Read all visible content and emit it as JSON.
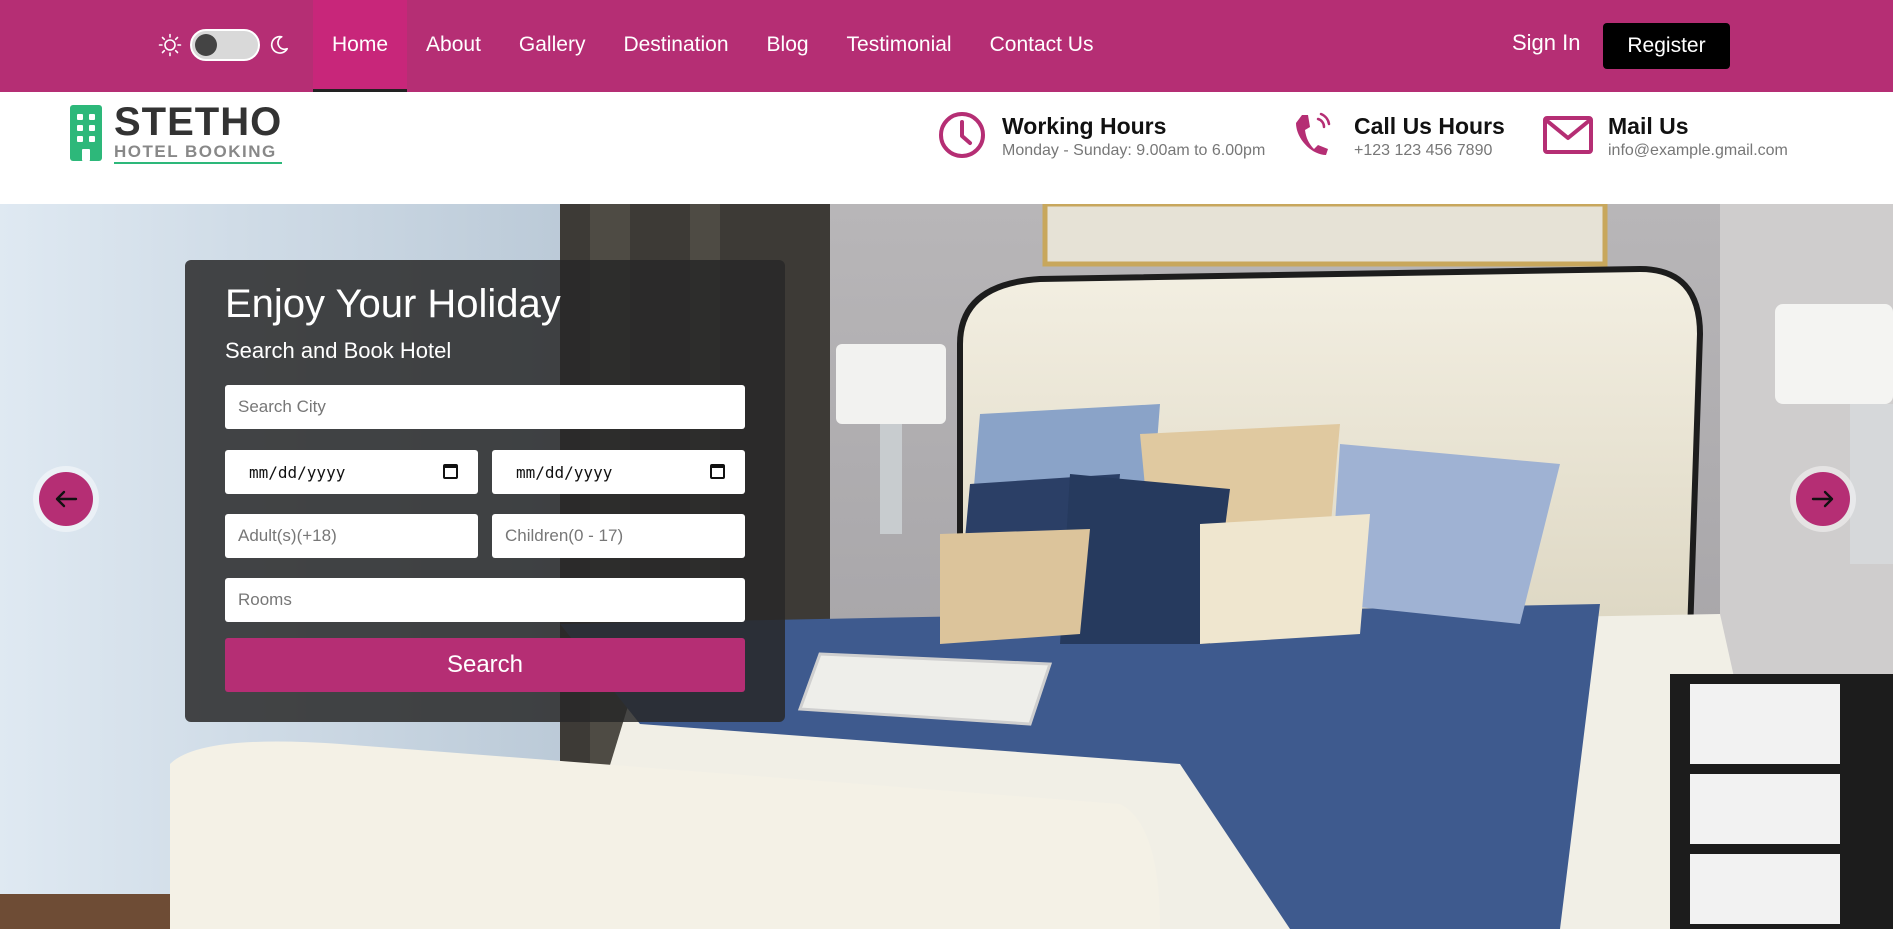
{
  "nav": {
    "links": [
      {
        "label": "Home",
        "active": true
      },
      {
        "label": "About"
      },
      {
        "label": "Gallery"
      },
      {
        "label": "Destination"
      },
      {
        "label": "Blog"
      },
      {
        "label": "Testimonial"
      },
      {
        "label": "Contact Us"
      }
    ],
    "sign_in": "Sign In",
    "register": "Register",
    "theme_toggle": {
      "light_icon": "sun-icon",
      "dark_icon": "moon-icon",
      "state": "off"
    }
  },
  "logo": {
    "title": "STETHO",
    "subtitle": "HOTEL BOOKING"
  },
  "info": {
    "working": {
      "title": "Working Hours",
      "sub": "Monday - Sunday: 9.00am to 6.00pm",
      "icon": "clock-icon"
    },
    "call": {
      "title": "Call Us Hours",
      "sub": "+123 123 456 7890",
      "icon": "phone-icon"
    },
    "mail": {
      "title": "Mail Us",
      "sub": "info@example.gmail.com",
      "icon": "mail-icon"
    }
  },
  "search": {
    "title": "Enjoy Your Holiday",
    "subtitle": "Search and Book Hotel",
    "city_placeholder": "Search City",
    "checkin_value": "mm/dd/yyyy",
    "checkout_value": "mm/dd/yyyy",
    "adults_placeholder": "Adult(s)(+18)",
    "children_placeholder": "Children(0 - 17)",
    "rooms_placeholder": "Rooms",
    "button": "Search"
  },
  "carousel": {
    "prev_icon": "arrow-left-icon",
    "next_icon": "arrow-right-icon"
  },
  "colors": {
    "brand": "#b52e74",
    "active_tab": "#c8267a",
    "logo_green": "#2db87a"
  }
}
